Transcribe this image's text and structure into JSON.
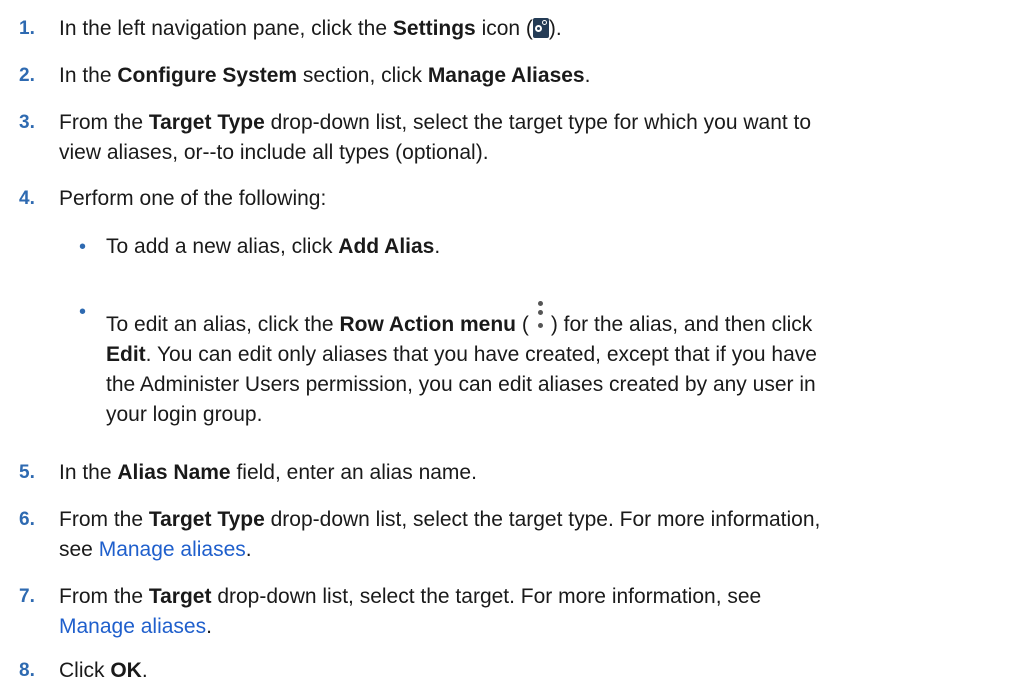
{
  "steps": [
    {
      "num": "1.",
      "t1": "In the left navigation pane, click the ",
      "b1": "Settings",
      "t2": " icon (",
      "icon": "settings-gear-icon",
      "t3": ")."
    },
    {
      "num": "2.",
      "t1": "In the ",
      "b1": "Configure System",
      "t2": " section, click ",
      "b2": "Manage Aliases",
      "t3": "."
    },
    {
      "num": "3.",
      "t1": "From the ",
      "b1": "Target Type",
      "t2": " drop-down list, select the target type for which you want to",
      "line2": "view aliases, or--to include all types (optional)."
    },
    {
      "num": "4.",
      "t1": "Perform one of the following:",
      "subs": [
        {
          "bullet": "•",
          "t1": "To add a new alias, click ",
          "b1": "Add Alias",
          "t2": "."
        },
        {
          "bullet": "•",
          "t1": "To edit an alias, click the ",
          "b1": "Row Action menu",
          "t2": " (",
          "icon": "kebab-menu-icon",
          "t3": ") for the alias, and then click",
          "b2": "Edit",
          "t4": ". You can edit only aliases that you have created, except that if you have",
          "line3": "the Administer Users permission, you can edit aliases created by any user in",
          "line4": "your login group."
        }
      ]
    },
    {
      "num": "5.",
      "t1": "In the ",
      "b1": "Alias Name",
      "t2": " field, enter an alias name."
    },
    {
      "num": "6.",
      "t1": "From the ",
      "b1": "Target Type",
      "t2": " drop-down list, select the target type. For more information,",
      "t3": "see ",
      "link": "Manage aliases",
      "t4": "."
    },
    {
      "num": "7.",
      "t1": "From the ",
      "b1": "Target",
      "t2": " drop-down list, select the target. For more information, see",
      "link": "Manage aliases",
      "t3": "."
    },
    {
      "num": "8.",
      "t1": "Click ",
      "b1": "OK",
      "t2": "."
    }
  ],
  "colors": {
    "step_number": "#2e6ab1",
    "link": "#1f5fcc",
    "text": "#1a1a1a"
  }
}
